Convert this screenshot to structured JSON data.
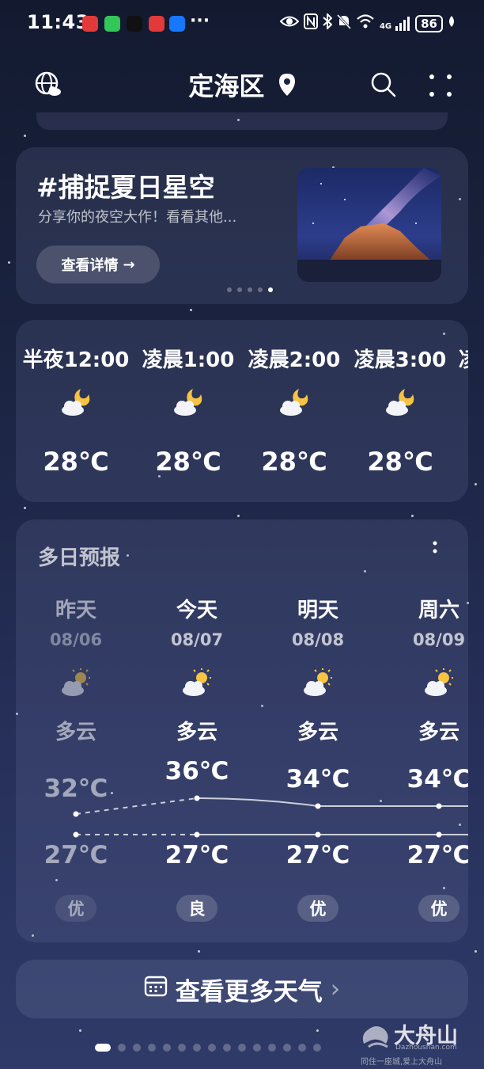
{
  "status_bar": {
    "time": "11:43",
    "battery": "86",
    "signal": "4G",
    "more": "···"
  },
  "header": {
    "location": "定海区",
    "icons": [
      "globe-cloud-icon",
      "location-pin-icon",
      "search-icon",
      "more-dots-icon"
    ]
  },
  "promo": {
    "title": "#捕捉夏日星空",
    "subtitle": "分享你的夜空大作！看看其他...",
    "button_label": "查看详情",
    "button_arrow": "→",
    "pages": 5,
    "active_page": 5
  },
  "hourly": [
    {
      "time": "半夜12:00",
      "icon": "partly-cloudy-night-icon",
      "temp": "28℃"
    },
    {
      "time": "凌晨1:00",
      "icon": "partly-cloudy-night-icon",
      "temp": "28℃"
    },
    {
      "time": "凌晨2:00",
      "icon": "partly-cloudy-night-icon",
      "temp": "28℃"
    },
    {
      "time": "凌晨3:00",
      "icon": "partly-cloudy-night-icon",
      "temp": "28℃"
    },
    {
      "time": "凌",
      "icon": "partly-cloudy-night-icon",
      "temp": ""
    }
  ],
  "daily": {
    "title": "多日预报",
    "days": [
      {
        "name": "昨天",
        "date": "08/06",
        "icon": "partly-cloudy-day-icon",
        "condition": "多云",
        "high": "32℃",
        "low": "27℃",
        "aqi": "优"
      },
      {
        "name": "今天",
        "date": "08/07",
        "icon": "partly-cloudy-day-icon",
        "condition": "多云",
        "high": "36℃",
        "low": "27℃",
        "aqi": "良"
      },
      {
        "name": "明天",
        "date": "08/08",
        "icon": "partly-cloudy-day-icon",
        "condition": "多云",
        "high": "34℃",
        "low": "27℃",
        "aqi": "优"
      },
      {
        "name": "周六",
        "date": "08/09",
        "icon": "partly-cloudy-day-icon",
        "condition": "多云",
        "high": "34℃",
        "low": "27℃",
        "aqi": "优"
      }
    ]
  },
  "more_weather": {
    "label": "查看更多天气",
    "arrow": "›"
  },
  "page_indicator": {
    "pages": 15,
    "active": 1
  },
  "watermark": {
    "brand": "大舟山",
    "url": "Dazhoushan.com",
    "slogan": "同住一座城,爱上大舟山"
  },
  "colors": {
    "background_top": "#131a30",
    "background_bottom": "#2f3a68",
    "card": "rgba(120,130,170,0.18)",
    "sun": "#f6c343",
    "moon": "#f6c343"
  }
}
